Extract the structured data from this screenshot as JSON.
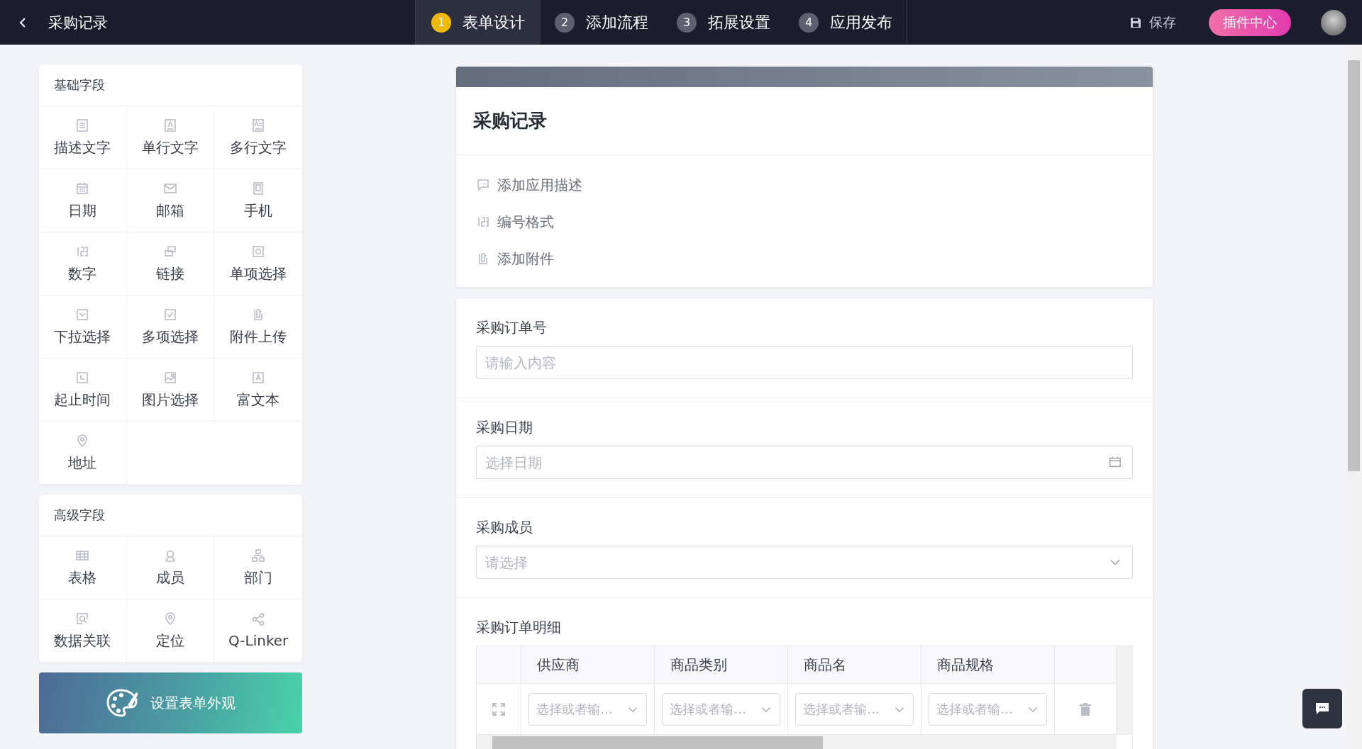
{
  "top_bar": {
    "title": "采购记录",
    "steps": [
      {
        "number": "1",
        "label": "表单设计",
        "selected": true
      },
      {
        "number": "2",
        "label": "添加流程",
        "selected": false
      },
      {
        "number": "3",
        "label": "拓展设置",
        "selected": false
      },
      {
        "number": "4",
        "label": "应用发布",
        "selected": false
      }
    ],
    "save": "保存",
    "plugin_button": "插件中心"
  },
  "sidebar": {
    "sections": [
      {
        "title": "基础字段",
        "items": [
          "描述文字",
          "单行文字",
          "多行文字",
          "日期",
          "邮箱",
          "手机",
          "数字",
          "链接",
          "单项选择",
          "下拉选择",
          "多项选择",
          "附件上传",
          "起止时间",
          "图片选择",
          "富文本",
          "地址"
        ]
      },
      {
        "title": "高级字段",
        "items": [
          "表格",
          "成员",
          "部门",
          "数据关联",
          "定位",
          "Q-Linker"
        ]
      }
    ],
    "appearance_button": "设置表单外观"
  },
  "form": {
    "title": "采购记录",
    "actions": [
      "添加应用描述",
      "编号格式",
      "添加附件"
    ],
    "fields": [
      {
        "kind": "text",
        "label": "采购订单号",
        "placeholder": "请输入内容"
      },
      {
        "kind": "date",
        "label": "采购日期",
        "placeholder": "选择日期"
      },
      {
        "kind": "select",
        "label": "采购成员",
        "placeholder": "请选择"
      },
      {
        "kind": "table",
        "label": "采购订单明细",
        "columns": [
          {
            "header": "供应商",
            "placeholder": "选择或者输…"
          },
          {
            "header": "商品类别",
            "placeholder": "选择或者输…"
          },
          {
            "header": "商品名",
            "placeholder": "选择或者输…"
          },
          {
            "header": "商品规格",
            "placeholder": "选择或者输…"
          }
        ]
      }
    ]
  }
}
